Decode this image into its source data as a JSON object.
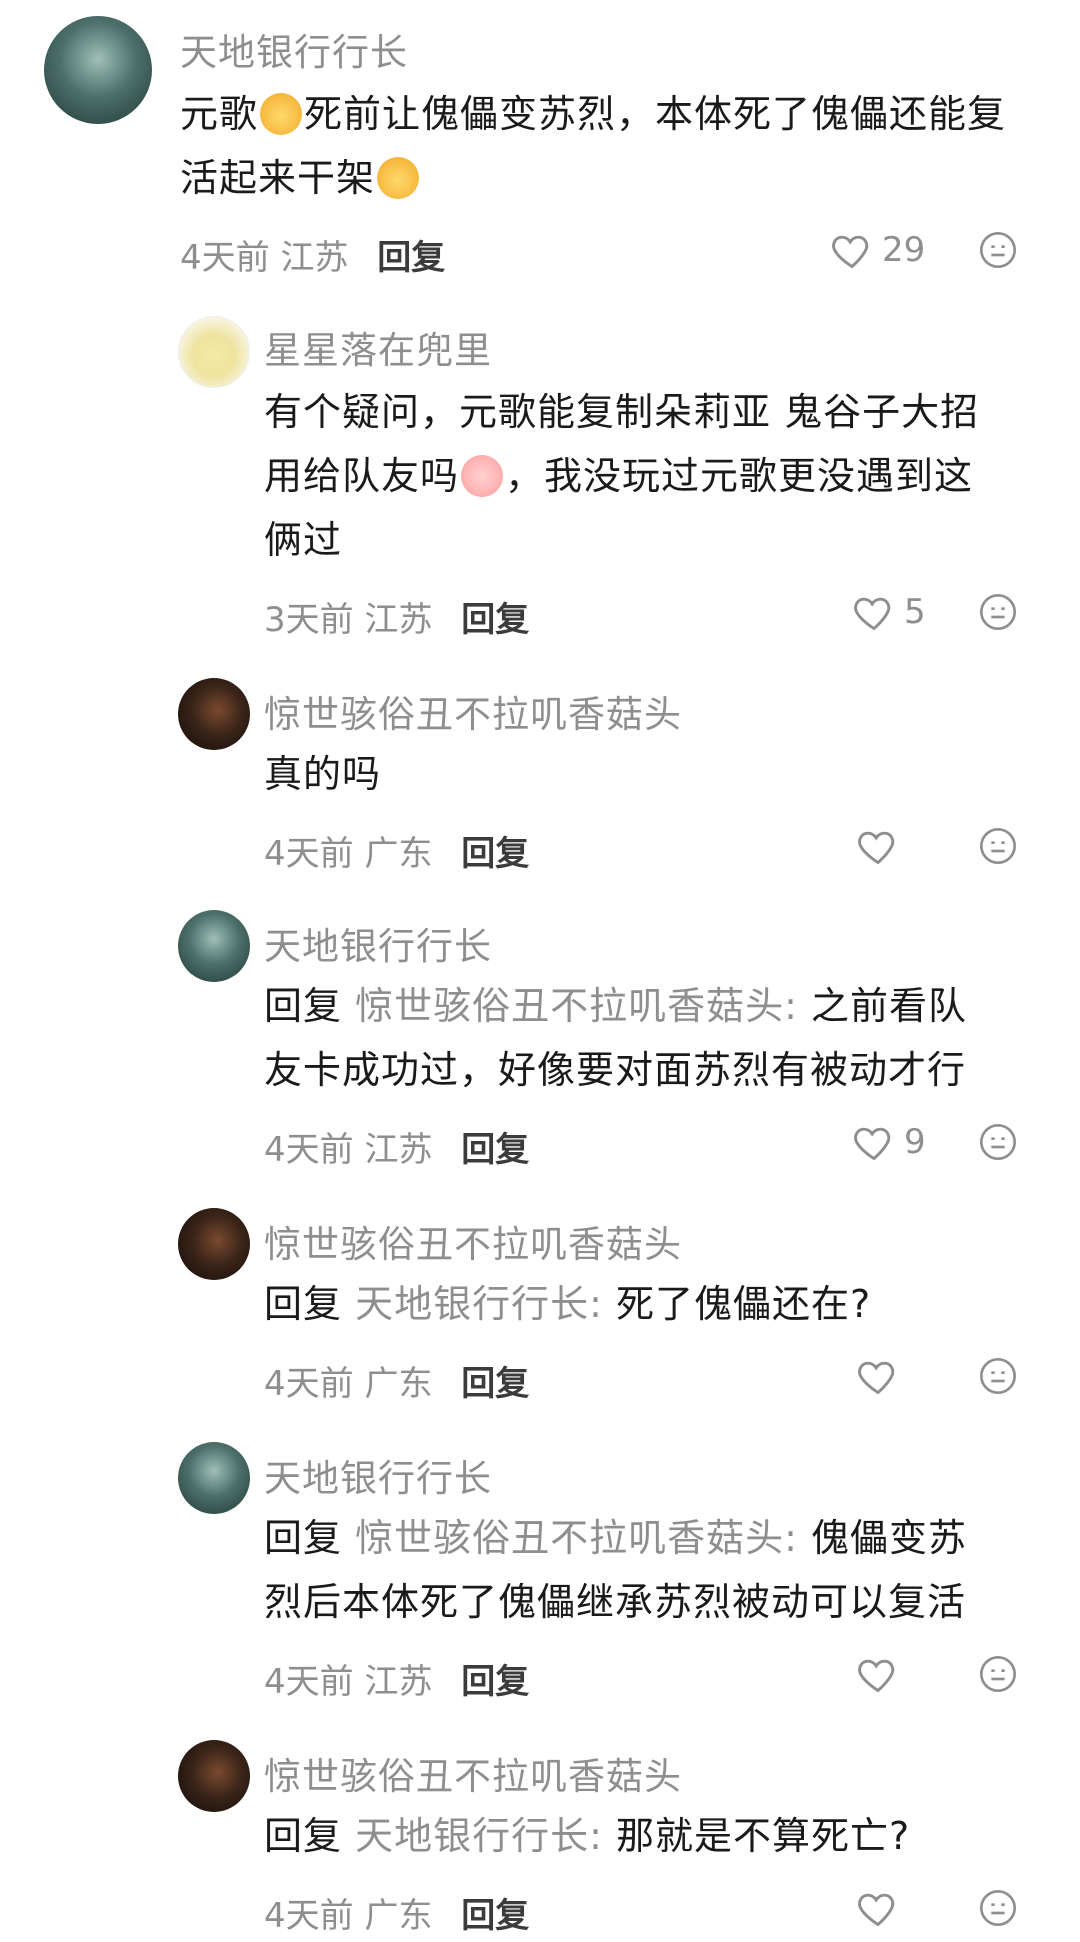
{
  "comments": [
    {
      "user": "天地银行行长",
      "text_parts": [
        "元歌",
        "死前让傀儡变苏烈，本体死了傀儡还能复",
        "活起来干架"
      ],
      "time": "4天前",
      "region": "江苏",
      "reply_label": "回复",
      "likes": "29"
    },
    {
      "user": "星星落在兜里",
      "text_parts": [
        "有个疑问，元歌能复制朵莉亚 鬼谷子大招",
        "用给队友吗",
        "，我没玩过元歌更没遇到这",
        "俩过"
      ],
      "time": "3天前",
      "region": "江苏",
      "reply_label": "回复",
      "likes": "5"
    },
    {
      "user": "惊世骇俗丑不拉叽香菇头",
      "text": "真的吗",
      "time": "4天前",
      "region": "广东",
      "reply_label": "回复",
      "likes": ""
    },
    {
      "user": "天地银行行长",
      "reply_prefix": "回复",
      "reply_target": "惊世骇俗丑不拉叽香菇头:",
      "text_line1": "之前看队",
      "text_line2": "友卡成功过，好像要对面苏烈有被动才行",
      "time": "4天前",
      "region": "江苏",
      "reply_label": "回复",
      "likes": "9"
    },
    {
      "user": "惊世骇俗丑不拉叽香菇头",
      "reply_prefix": "回复",
      "reply_target": "天地银行行长:",
      "text_line1": "死了傀儡还在?",
      "time": "4天前",
      "region": "广东",
      "reply_label": "回复",
      "likes": ""
    },
    {
      "user": "天地银行行长",
      "reply_prefix": "回复",
      "reply_target": "惊世骇俗丑不拉叽香菇头:",
      "text_line1": "傀儡变苏",
      "text_line2": "烈后本体死了傀儡继承苏烈被动可以复活",
      "time": "4天前",
      "region": "江苏",
      "reply_label": "回复",
      "likes": ""
    },
    {
      "user": "惊世骇俗丑不拉叽香菇头",
      "reply_prefix": "回复",
      "reply_target": "天地银行行长:",
      "text_line1": "那就是不算死亡?",
      "time": "4天前",
      "region": "广东",
      "reply_label": "回复",
      "likes": ""
    }
  ],
  "icons": {
    "like": "heart-outline-icon",
    "more": "face-neutral-icon"
  },
  "colors": {
    "username": "#8e8e8e",
    "text": "#1a1a1a",
    "meta": "#8e8e8e"
  }
}
